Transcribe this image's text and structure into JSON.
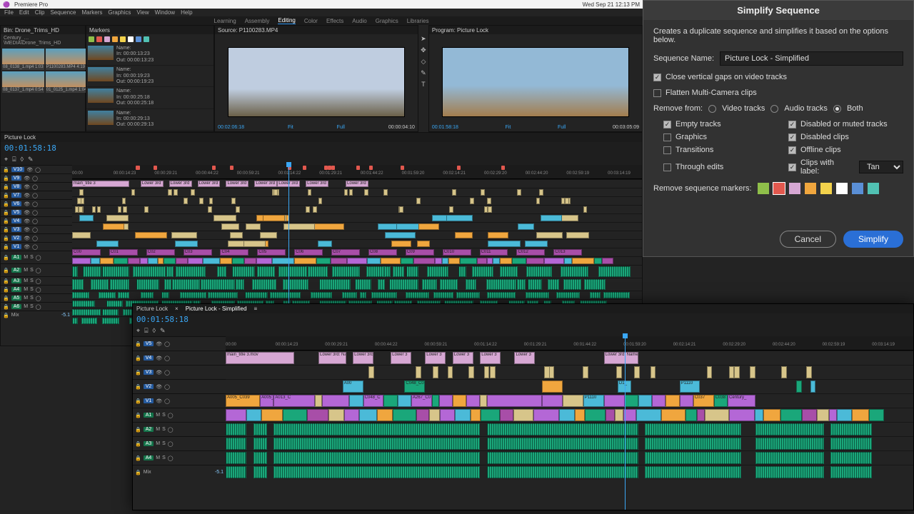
{
  "app": {
    "name": "Premiere Pro",
    "menu": [
      "File",
      "Edit",
      "Clip",
      "Sequence",
      "Markers",
      "Graphics",
      "View",
      "Window",
      "Help"
    ],
    "mac_right": "Wed Sep 21  12:13 PM"
  },
  "workspace_tabs": [
    "Learning",
    "Assembly",
    "Editing",
    "Color",
    "Effects",
    "Audio",
    "Graphics",
    "Libraries"
  ],
  "workspace_active": "Editing",
  "project": {
    "bin_title": "Bin: Drone_Trims_HD",
    "crumb": "Century_…\\MEDIA\\Drone_Trims_HD",
    "thumbs": [
      {
        "name": "08_0138_1.mp4",
        "dur": "1:03"
      },
      {
        "name": "P1100283.MP4",
        "dur": "4:19"
      },
      {
        "name": "08_0137_1.mp4",
        "dur": "0:54"
      },
      {
        "name": "01_0125_1.mp4",
        "dur": "1:04"
      }
    ]
  },
  "markers": {
    "title": "Markers",
    "colors": [
      "#8fbf4a",
      "#e2584e",
      "#d6a7d3",
      "#f0a63e",
      "#f3d24c",
      "#ffffff",
      "#5a8fd6",
      "#51c1b3"
    ],
    "items": [
      {
        "name": "Name:",
        "in": "In: 00:00:13:23",
        "out": "Out: 00:00:13:23"
      },
      {
        "name": "Name:",
        "in": "In: 00:00:19:23",
        "out": "Out: 00:00:19:23"
      },
      {
        "name": "Name:",
        "in": "In: 00:00:25:18",
        "out": "Out: 00:00:25:18"
      },
      {
        "name": "Name:",
        "in": "In: 00:00:29:13",
        "out": "Out: 00:00:29:13"
      }
    ]
  },
  "source": {
    "title": "Source: P1100283.MP4",
    "tc_left": "00:02:06:18",
    "tc_right": "00:00:04:10",
    "fit": "Fit",
    "half": "Full"
  },
  "program": {
    "title": "Program: Picture Lock",
    "tc_left": "00:01:58:18",
    "tc_right": "00:03:05:09",
    "fit": "Fit",
    "half": "Full"
  },
  "timeline": {
    "seq_tab": "Picture Lock",
    "playhead_tc": "00:01:58:18",
    "ruler_ticks": [
      "00:00",
      "00:00:14:23",
      "00:00:29:21",
      "00:00:44:22",
      "00:00:59:21",
      "00:01:14:22",
      "00:01:29:21",
      "00:01:44:22",
      "00:01:59:20",
      "00:02:14:21",
      "00:02:29:20",
      "00:02:44:20",
      "00:02:59:19",
      "00:03:14:19"
    ],
    "marker_colors": [
      "#e2584e",
      "#e2584e",
      "#e2584e",
      "#e2584e",
      "#e2584e",
      "#e2584e",
      "#e2584e",
      "#e2584e",
      "#e2584e",
      "#e2584e",
      "#e2584e",
      "#e2584e",
      "#e2584e",
      "#e2584e",
      "#e2584e"
    ],
    "v_tracks": [
      "V10",
      "V9",
      "V8",
      "V7",
      "V6",
      "V5",
      "V4",
      "V3",
      "V2",
      "V1"
    ],
    "a_tracks": [
      "A1",
      "A2",
      "A3",
      "A4",
      "A5",
      "A6"
    ],
    "mix_label": "Mix",
    "mix_val": "-5.1"
  },
  "simp_timeline": {
    "tabs": [
      "Picture Lock",
      "Picture Lock - Simplified"
    ],
    "active_tab": 1,
    "playhead_tc": "00:01:58:18",
    "ruler_ticks": [
      "00:00",
      "00:00:14:23",
      "00:00:29:21",
      "00:00:44:22",
      "00:00:59:21",
      "00:01:14:22",
      "00:01:29:21",
      "00:01:44:22",
      "00:01:59:20",
      "00:02:14:21",
      "00:02:29:20",
      "00:02:44:20",
      "00:02:59:19",
      "00:03:14:19"
    ],
    "v_tracks": [
      "V5",
      "V4",
      "V3",
      "V2",
      "V1"
    ],
    "a_tracks": [
      "A1",
      "A2",
      "A3",
      "A4"
    ],
    "mix_label": "Mix",
    "mix_val": "-5.1",
    "v5_clips": [
      {
        "l": 0,
        "w": 10,
        "c": "#d6a7d3",
        "t": "main_title 3.mov"
      },
      {
        "l": 13.5,
        "w": 4,
        "c": "#d6a7d3",
        "t": "Lower 3rd: Nam"
      },
      {
        "l": 18.5,
        "w": 3,
        "c": "#d6a7d3",
        "t": "Lower 3rd:"
      },
      {
        "l": 24,
        "w": 3,
        "c": "#d6a7d3",
        "t": "Lower 3"
      },
      {
        "l": 29,
        "w": 3,
        "c": "#d6a7d3",
        "t": "Lower 3"
      },
      {
        "l": 33,
        "w": 3,
        "c": "#d6a7d3",
        "t": "Lower 3"
      },
      {
        "l": 37,
        "w": 3,
        "c": "#d6a7d3",
        "t": "Lower 3"
      },
      {
        "l": 42,
        "w": 3,
        "c": "#d6a7d3",
        "t": "Lower 3"
      },
      {
        "l": 55,
        "w": 5,
        "c": "#d6a7d3",
        "t": "Lower 3rd: Name"
      }
    ],
    "a_wave_segs": [
      {
        "l": 0,
        "w": 3
      },
      {
        "l": 4,
        "w": 2
      },
      {
        "l": 7,
        "w": 30
      },
      {
        "l": 38,
        "w": 22
      },
      {
        "l": 61,
        "w": 14
      },
      {
        "l": 77,
        "w": 10
      },
      {
        "l": 88,
        "w": 6
      }
    ]
  },
  "dialog": {
    "title": "Simplify Sequence",
    "desc": "Creates a duplicate sequence and simplifies it based on the options below.",
    "seq_name_label": "Sequence Name:",
    "seq_name_value": "Picture Lock - Simplified",
    "close_gaps": "Close vertical gaps on video tracks",
    "flatten": "Flatten Multi-Camera clips",
    "remove_from": "Remove from:",
    "radio_video": "Video tracks",
    "radio_audio": "Audio tracks",
    "radio_both": "Both",
    "empty": "Empty tracks",
    "graphics": "Graphics",
    "transitions": "Transitions",
    "through": "Through edits",
    "disabled_muted": "Disabled or muted tracks",
    "disabled_clips": "Disabled clips",
    "offline": "Offline clips",
    "with_label": "Clips with label:",
    "label_sel": "Tan",
    "remove_markers": "Remove sequence markers:",
    "swatches": [
      "#8fbf4a",
      "#e2584e",
      "#d6a7d3",
      "#f0a63e",
      "#f3d24c",
      "#ffffff",
      "#5a8fd6",
      "#51c1b3"
    ],
    "cancel": "Cancel",
    "simplify": "Simplify"
  }
}
